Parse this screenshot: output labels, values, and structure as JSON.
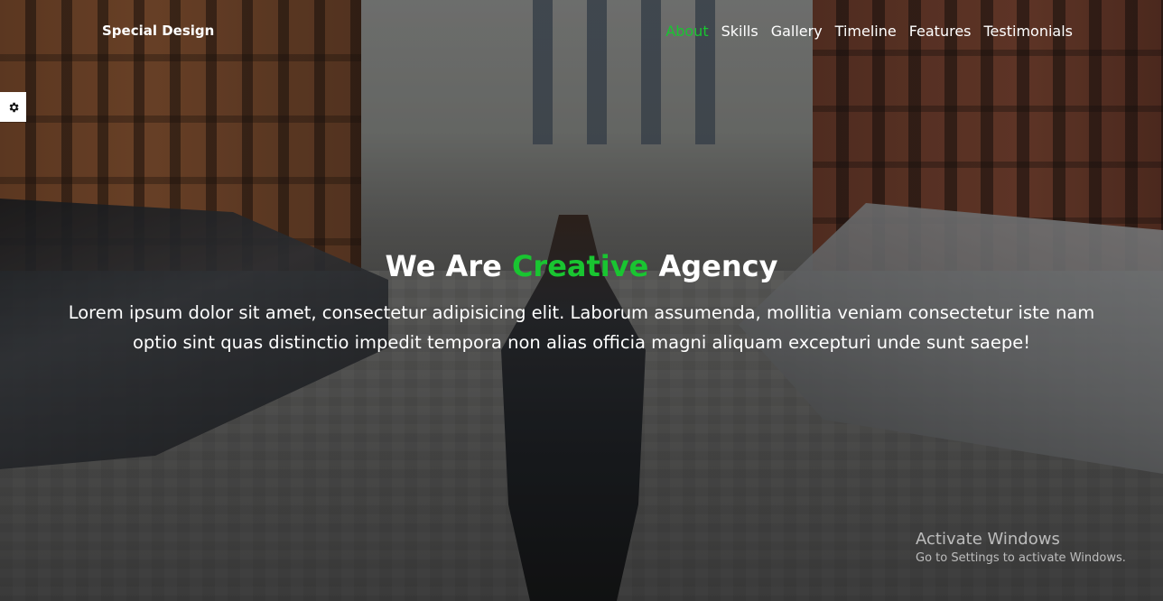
{
  "header": {
    "brand": "Special Design",
    "nav": [
      {
        "label": "About",
        "active": true
      },
      {
        "label": "Skills",
        "active": false
      },
      {
        "label": "Gallery",
        "active": false
      },
      {
        "label": "Timeline",
        "active": false
      },
      {
        "label": "Features",
        "active": false
      },
      {
        "label": "Testimonials",
        "active": false
      }
    ]
  },
  "settings": {
    "icon": "gear-icon"
  },
  "hero": {
    "headline_pre": "We Are",
    "headline_accent": "Creative",
    "headline_post": "Agency",
    "lead": "Lorem ipsum dolor sit amet, consectetur adipisicing elit. Laborum assumenda, mollitia veniam consectetur iste nam optio sint quas distinctio impedit tempora non alias officia magni aliquam excepturi unde sunt saepe!"
  },
  "watermark": {
    "title": "Activate Windows",
    "subtitle": "Go to Settings to activate Windows."
  },
  "colors": {
    "accent": "#19c531",
    "text": "#ffffff"
  }
}
